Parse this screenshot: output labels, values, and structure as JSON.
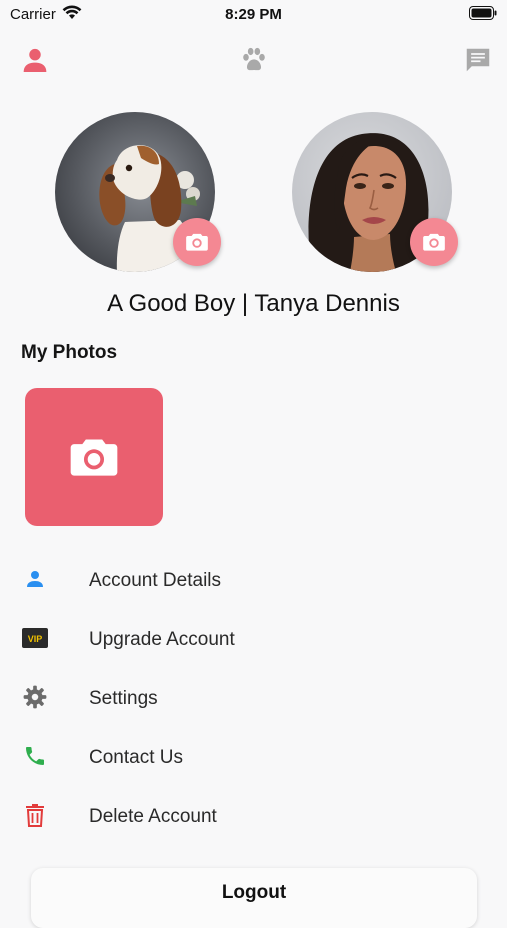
{
  "status_bar": {
    "carrier": "Carrier",
    "time": "8:29 PM"
  },
  "top_nav": {
    "profile_icon": "person-icon",
    "pets_icon": "paw-icon",
    "messages_icon": "message-icon"
  },
  "profile": {
    "pet_avatar": "dog-photo",
    "owner_avatar": "woman-photo",
    "name": "A Good Boy | Tanya Dennis"
  },
  "photos": {
    "title": "My Photos"
  },
  "menu": {
    "items": [
      {
        "label": "Account Details",
        "icon": "person-icon"
      },
      {
        "label": "Upgrade Account",
        "icon": "vip-icon"
      },
      {
        "label": "Settings",
        "icon": "gear-icon"
      },
      {
        "label": "Contact Us",
        "icon": "phone-icon"
      },
      {
        "label": "Delete Account",
        "icon": "trash-icon"
      }
    ]
  },
  "logout": {
    "label": "Logout"
  },
  "colors": {
    "accent": "#ea5f6f",
    "badge": "#f48893",
    "blue": "#2a8ff0",
    "green": "#2fae4e",
    "red": "#e23b3b"
  }
}
